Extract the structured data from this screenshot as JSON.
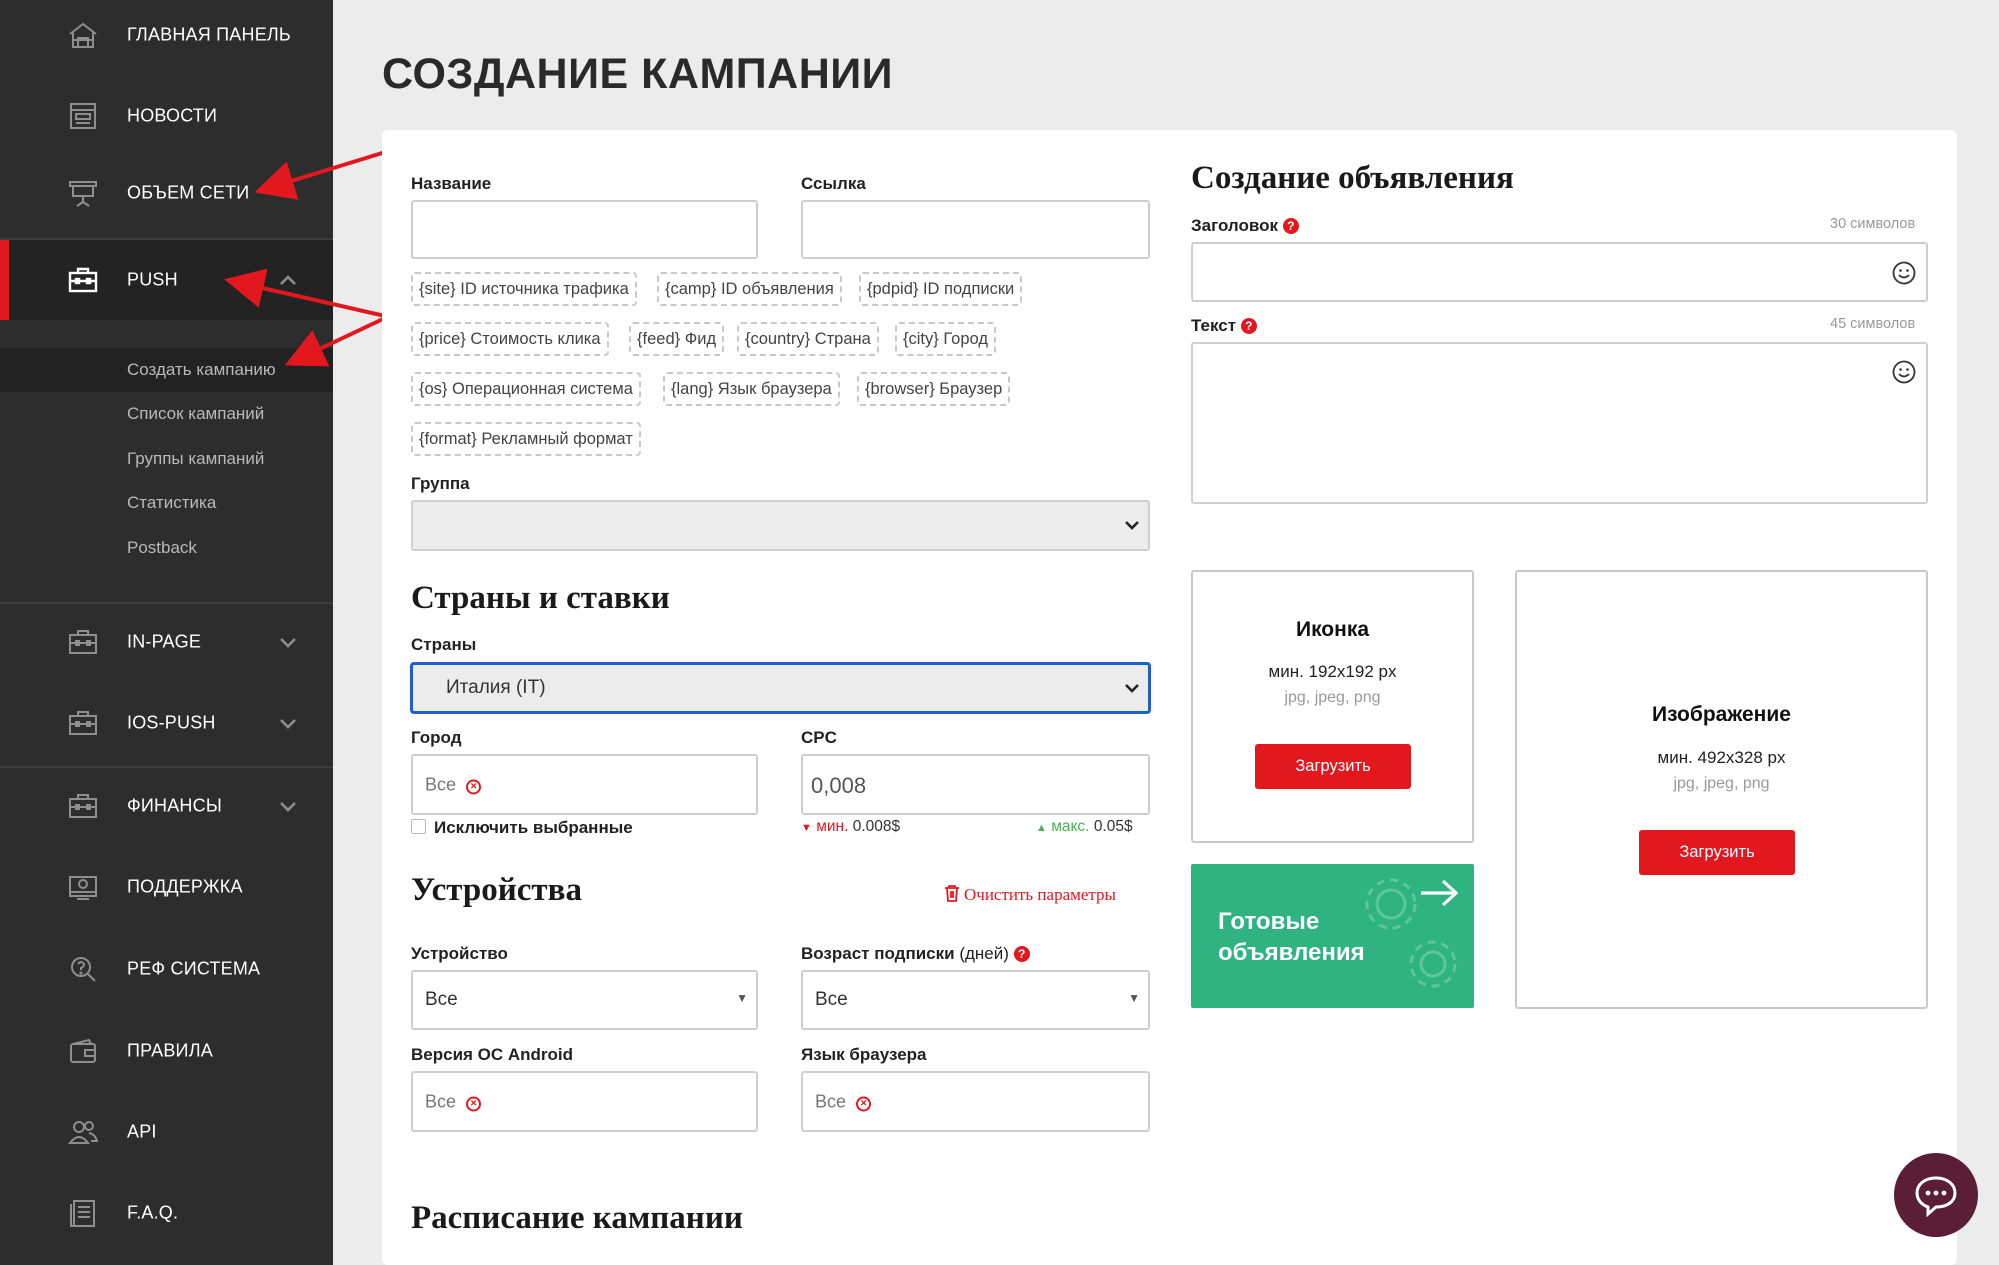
{
  "sidebar": {
    "items": [
      {
        "label": "ГЛАВНАЯ ПАНЕЛЬ",
        "icon": "home-icon"
      },
      {
        "label": "НОВОСТИ",
        "icon": "news-icon"
      },
      {
        "label": "ОБЪЕМ СЕТИ",
        "icon": "network-volume-icon"
      },
      {
        "label": "PUSH",
        "icon": "briefcase-icon"
      },
      {
        "label": "IN-PAGE",
        "icon": "briefcase-icon"
      },
      {
        "label": "IOS-PUSH",
        "icon": "briefcase-icon"
      },
      {
        "label": "ФИНАНСЫ",
        "icon": "briefcase-icon"
      },
      {
        "label": "ПОДДЕРЖКА",
        "icon": "support-icon"
      },
      {
        "label": "РЕФ СИСТЕМА",
        "icon": "referral-icon"
      },
      {
        "label": "ПРАВИЛА",
        "icon": "wallet-icon"
      },
      {
        "label": "API",
        "icon": "users-icon"
      },
      {
        "label": "F.A.Q.",
        "icon": "document-icon"
      }
    ],
    "push_submenu": [
      "Создать кампанию",
      "Список кампаний",
      "Группы кампаний",
      "Статистика",
      "Postback"
    ]
  },
  "page": {
    "title": "СОЗДАНИЕ КАМПАНИИ"
  },
  "form": {
    "name_label": "Название",
    "link_label": "Ссылка",
    "macros": [
      "{site} ID источника трафика",
      "{camp} ID объявления",
      "{pdpid} ID подписки",
      "{price} Стоимость клика",
      "{feed} Фид",
      "{country} Страна",
      "{city} Город",
      "{os} Операционная система",
      "{lang} Язык браузера",
      "{browser} Браузер",
      "{format} Рекламный формат"
    ],
    "group_label": "Группа",
    "countries_heading": "Страны и ставки",
    "countries_label": "Страны",
    "countries_value": "Италия (IT)",
    "city_label": "Город",
    "city_chip": "Все",
    "exclude_label": "Исключить выбранные",
    "cpc_label": "CPC",
    "cpc_value": "0,008",
    "cpc_min_label": "мин.",
    "cpc_min_value": "0.008$",
    "cpc_max_label": "макс.",
    "cpc_max_value": "0.05$",
    "devices_heading": "Устройства",
    "clear_params": "Очистить параметры",
    "device_label": "Устройство",
    "device_value": "Все",
    "sub_age_label": "Возраст подписки",
    "sub_age_unit": " (дней)",
    "sub_age_value": "Все",
    "android_label": "Версия ОС Android",
    "android_chip": "Все",
    "lang_label": "Язык браузера",
    "lang_chip": "Все",
    "schedule_heading": "Расписание кампании"
  },
  "ad": {
    "heading": "Создание объявления",
    "title_label": "Заголовок",
    "title_limit": "30 символов",
    "text_label": "Текст",
    "text_limit": "45 символов",
    "icon_box": {
      "title": "Иконка",
      "size": "мин. 192x192 px",
      "formats": "jpg, jpeg, png",
      "button": "Загрузить"
    },
    "image_box": {
      "title": "Изображение",
      "size": "мин. 492x328 px",
      "formats": "jpg, jpeg, png",
      "button": "Загрузить"
    },
    "ready_ads": "Готовые объявления"
  },
  "colors": {
    "accent": "#e3181f",
    "sidebar": "#2d2d2d",
    "green": "#2fb380",
    "focus": "#1c5fd0",
    "chat": "#5a1e37"
  }
}
